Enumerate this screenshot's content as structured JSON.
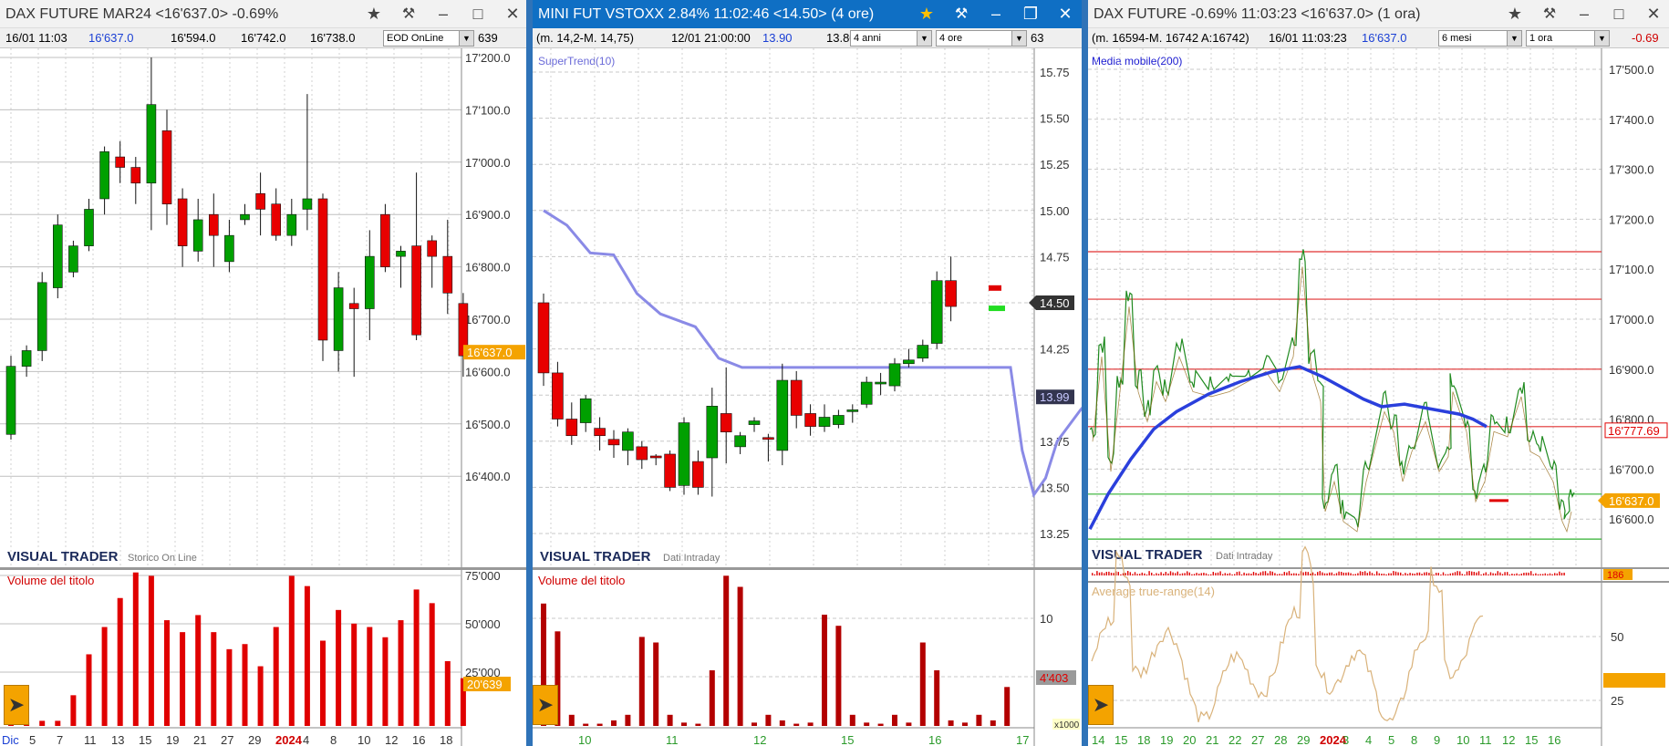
{
  "windows": [
    {
      "title": "DAX FUTURE MAR24 <16'637.0> -0.69%",
      "info": {
        "datetime": "16/01 11:03",
        "last": "16'637.0",
        "open": "16'594.0",
        "high": "16'742.0",
        "low": "16'738.0",
        "source_select": "EOD OnLine",
        "tail": "639"
      },
      "price_axis": [
        "17'200.0",
        "17'100.0",
        "17'000.0",
        "16'900.0",
        "16'800.0",
        "16'700.0",
        "16'600.0",
        "16'500.0",
        "16'400.0"
      ],
      "price_tag": "16'637.0",
      "brand": "VISUAL TRADER",
      "brand_sub": "Storico On Line",
      "volume_label": "Volume del titolo",
      "volume_axis": [
        "75'000",
        "50'000",
        "25'000"
      ],
      "volume_tag": "20'639",
      "time_axis": [
        "Dic",
        "5",
        "7",
        "11",
        "13",
        "15",
        "19",
        "21",
        "27",
        "29",
        "2024",
        "4",
        "8",
        "10",
        "12",
        "16",
        "18"
      ]
    },
    {
      "title": "MINI FUT VSTOXX 2.84% 11:02:46  <14.50> (4 ore)",
      "info": {
        "range": "(m. 14,2-M. 14,75)",
        "datetime": "12/01 21:00:00",
        "value1": "13.90",
        "value2": "13.80",
        "period_select": "4 anni",
        "interval_select": "4 ore",
        "tail": "63"
      },
      "indicator": "SuperTrend(10)",
      "price_axis": [
        "15.75",
        "15.50",
        "15.25",
        "15.00",
        "14.75",
        "14.50",
        "14.25",
        "14.00",
        "13.75",
        "13.50",
        "13.25"
      ],
      "price_tag": "14.50",
      "supertrend_tag": "13.99",
      "brand": "VISUAL TRADER",
      "brand_sub": "Dati Intraday",
      "volume_label": "Volume del titolo",
      "volume_axis": [
        "10",
        "5"
      ],
      "volume_tag": "4'403",
      "volume_unit": "x1000",
      "time_axis": [
        "10",
        "11",
        "12",
        "15",
        "16",
        "17"
      ]
    },
    {
      "title": "DAX FUTURE -0.69% 11:03:23 <16'637.0> (1 ora)",
      "info": {
        "range": "(m. 16594-M. 16742 A:16742)",
        "datetime": "16/01 11:03:23",
        "last": "16'637.0",
        "period_select": "6 mesi",
        "interval_select": "1 ora",
        "change": "-0.69"
      },
      "indicator": "Media mobile(200)",
      "price_axis": [
        "17'500.0",
        "17'400.0",
        "17'300.0",
        "17'200.0",
        "17'100.0",
        "17'000.0",
        "16'900.0",
        "16'800.0",
        "16'700.0",
        "16'600.0"
      ],
      "ma_tag": "16'777.69",
      "price_tag": "16'637.0",
      "brand": "VISUAL TRADER",
      "brand_sub": "Dati Intraday",
      "volume_tag": "186",
      "atr_label": "Average true-range(14)",
      "atr_axis": [
        "50",
        "25"
      ],
      "time_axis": [
        "14",
        "15",
        "18",
        "19",
        "20",
        "21",
        "22",
        "27",
        "28",
        "29",
        "2024",
        "3",
        "4",
        "5",
        "8",
        "9",
        "10",
        "11",
        "12",
        "15",
        "16"
      ]
    }
  ],
  "colors": {
    "up": "#00a000",
    "down": "#e80000",
    "active_title": "#0f6fc4",
    "supertrend": "#8a8ae6",
    "ma": "#2a3fdc",
    "atr": "#d9b27a",
    "tag": "#f4a300"
  },
  "icons": [
    "star-icon",
    "pin-icon",
    "minimize-icon",
    "maximize-icon",
    "close-icon",
    "dropdown-arrow-icon",
    "play-icon"
  ]
}
